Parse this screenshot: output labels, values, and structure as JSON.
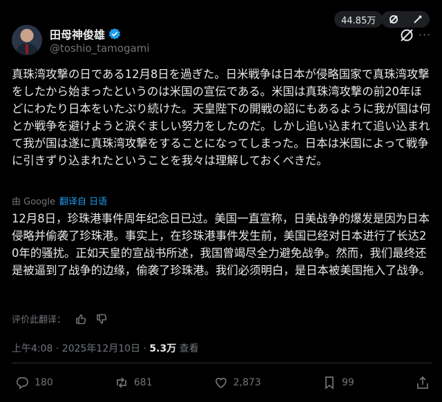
{
  "top": {
    "view_count": "44.85万"
  },
  "author": {
    "name": "田母神俊雄",
    "handle": "@toshio_tamogami"
  },
  "post": {
    "text": "真珠湾攻撃の日である12月8日を過ぎた。日米戦争は日本が侵略国家で真珠湾攻撃をしたから始まったというのは米国の宣伝である。米国は真珠湾攻撃の前20年ほどにわたり日本をいたぶり続けた。天皇陛下の開戦の詔にもあるように我が国は何とか戦争を避けようと涙ぐましい努力をしたのだ。しかし追い込まれて追い込まれて我が国は遂に真珠湾攻撃をすることになってしまった。日本は米国によって戦争に引きずり込まれたということを我々は理解しておくべきだ。"
  },
  "translation": {
    "by_label": "由 Google",
    "translated_from": "翻译自 日语",
    "text": "12月8日，珍珠港事件周年纪念日已过。美国一直宣称，日美战争的爆发是因为日本侵略并偷袭了珍珠港。事实上，在珍珠港事件发生前，美国已经对日本进行了长达20年的骚扰。正如天皇的宣战书所述，我国曾竭尽全力避免战争。然而，我们最终还是被逼到了战争的边缘，偷袭了珍珠港。我们必须明白，是日本被美国拖入了战争。",
    "rate_label": "评价此翻译："
  },
  "meta": {
    "time_date": "上午4:08 · 2025年12月10日 · ",
    "views": "5.3万",
    "views_label": " 查看"
  },
  "actions": {
    "replies": "180",
    "reposts": "681",
    "likes": "2,873",
    "bookmarks": "99"
  },
  "colors": {
    "accent": "#1d9bf0",
    "muted": "#71767b",
    "background": "#000000"
  },
  "icons": [
    "eye-off-icon",
    "edit-icon",
    "verified-badge-icon",
    "grok-icon",
    "more-icon",
    "thumbs-up-icon",
    "thumbs-down-icon",
    "reply-icon",
    "repost-icon",
    "like-icon",
    "bookmark-icon",
    "share-icon"
  ]
}
